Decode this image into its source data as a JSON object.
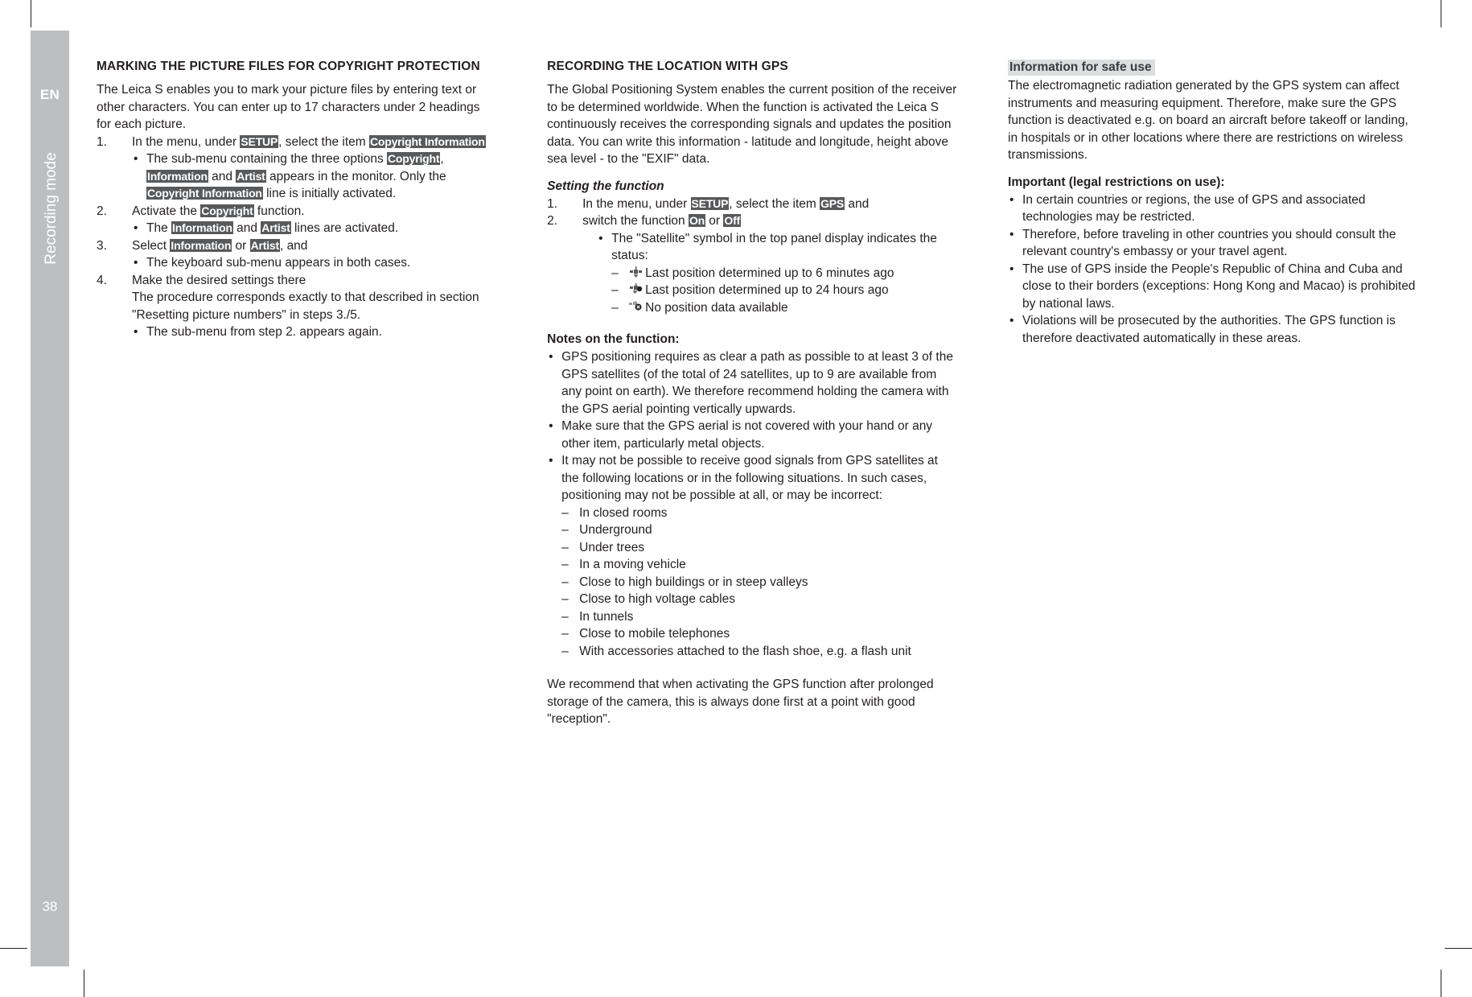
{
  "sidebar": {
    "language": "EN",
    "chapter": "Recording mode",
    "page_number": "38",
    "color": "#bcbec0"
  },
  "left_column": {
    "title": "MARKING THE PICTURE FILES FOR COPYRIGHT PROTECTION",
    "intro": "The Leica S enables you to mark your picture files by entering text or other characters. You can enter up to 17 characters under 2 headings for each picture.",
    "steps": [
      {
        "num": "1.",
        "text_parts": [
          "In the menu, under ",
          "SETUP",
          ", select the item ",
          "Copyright Information"
        ],
        "sub_bullets": [
          "The sub-menu containing the three options Copyright, Information and Artist appears in the monitor. Only the Copyright Information line is initially activated."
        ]
      },
      {
        "num": "2.",
        "text_parts": [
          "Activate the ",
          "Copyright",
          " function."
        ],
        "sub_bullets": [
          "The Information and Artist lines are activated."
        ]
      },
      {
        "num": "3.",
        "text_parts": [
          " Select ",
          "Information",
          " or ",
          "Artist",
          ", and"
        ],
        "sub_bullets": [
          "The keyboard sub-menu appears in both cases."
        ]
      },
      {
        "num": "4.",
        "text_parts": [
          "Make the desired settings there"
        ],
        "continuation": "The procedure corresponds exactly to that described in section \"Resetting picture numbers\" in steps 3./5.",
        "sub_bullets": [
          "The sub-menu from step 2. appears again."
        ]
      }
    ],
    "tokens": {
      "setup": "SETUP",
      "copyright_information": "Copyright Information",
      "copyright": "Copyright",
      "information": "Information",
      "artist": "Artist"
    },
    "step1_sub_a": "The sub-menu containing the three options ",
    "step1_sub_b": ", ",
    "step1_sub_c": " and ",
    "step1_sub_d": " appears in the monitor. Only the ",
    "step1_sub_e": " line is initially activated.",
    "step2_a": "Activate the ",
    "step2_b": " function.",
    "step2_sub_a": "The ",
    "step2_sub_b": " and ",
    "step2_sub_c": " lines are activated.",
    "step3_a": " Select ",
    "step3_b": " or ",
    "step3_c": ", and",
    "step3_sub": "The keyboard sub-menu appears in both cases.",
    "step4_a": "Make the desired settings there",
    "step4_b": "The procedure corresponds exactly to that described in section \"Resetting picture numbers\" in steps 3./5.",
    "step4_sub": "The sub-menu from step 2. appears again.",
    "step1_a": "In the menu, under ",
    "step1_b": ", select the item "
  },
  "middle_column": {
    "title": "RECORDING THE LOCATION WITH GPS",
    "intro": "The Global Positioning System enables the current position of the receiver to be determined worldwide. When the function is activated the Leica S continuously receives the corresponding signals and updates the position data. You can write this information - latitude and longitude, height above sea level - to the \"EXIF\" data.",
    "setting_title": "Setting the function",
    "setting_step1_a": "In the menu, under ",
    "setting_step1_b": ", select the item ",
    "setting_step1_c": " and",
    "setting_step2_a": "switch the function ",
    "setting_step2_b": " or ",
    "setting_step2_c": "",
    "tokens": {
      "setup": "SETUP",
      "gps": "GPS",
      "on": "On",
      "off": "Off"
    },
    "num1": "1.",
    "num2": "2.",
    "satellite_bullet": "The \"Satellite\" symbol in the top panel display indicates the status:",
    "satellite_states": [
      {
        "icon": "satellite-strong-icon",
        "label": "Last position determined up to 6 minutes ago"
      },
      {
        "icon": "satellite-weak-icon",
        "label": "Last position determined up to 24 hours ago"
      },
      {
        "icon": "satellite-none-icon",
        "label": "No position data available"
      }
    ],
    "notes_title": "Notes on the function:",
    "notes": [
      "GPS positioning requires as clear a path as possible to at least 3 of the GPS satellites (of the total of 24 satellites, up to 9 are available from any point on earth). We therefore recommend holding the camera with the GPS aerial pointing vertically upwards.",
      "Make sure that the GPS aerial is not covered with your hand or any other item, particularly metal objects.",
      "It may not be possible to receive good signals from GPS satellites at the following locations or in the following situations. In such cases, positioning may not be possible at all, or may be incorrect:"
    ],
    "locations": [
      "In closed rooms",
      "Underground",
      "Under trees",
      "In a moving vehicle",
      "Close to high buildings or in steep valleys",
      "Close to high voltage cables",
      "In tunnels",
      "Close to mobile telephones",
      "With accessories attached to the flash shoe, e.g. a flash unit"
    ],
    "closing": "We recommend that when activating the GPS function after prolonged storage of the camera, this is always done first at a point with good \"reception\"."
  },
  "right_column": {
    "safe_use_title": "Information for safe use",
    "safe_use_highlight_color": "#dcdddf",
    "safe_use_text": "The electromagnetic radiation generated by the GPS system can affect instruments and measuring equipment. Therefore, make sure the GPS function is deactivated e.g. on board an aircraft before takeoff or landing, in hospitals or in other locations where there are restrictions on wireless transmissions.",
    "important_title": "Important (legal restrictions on use):",
    "important_bullets": [
      "In certain countries or regions, the use of GPS and associated technologies may be restricted.",
      "Therefore, before traveling in other countries you should consult the relevant country's embassy or your travel agent.",
      "The use of GPS inside the People's Republic of China and Cuba and close to their borders (exceptions: Hong Kong and Macao) is prohibited by national laws.",
      "Violations will be prosecuted by the authorities. The GPS function is therefore deactivated automatically in these areas."
    ]
  }
}
